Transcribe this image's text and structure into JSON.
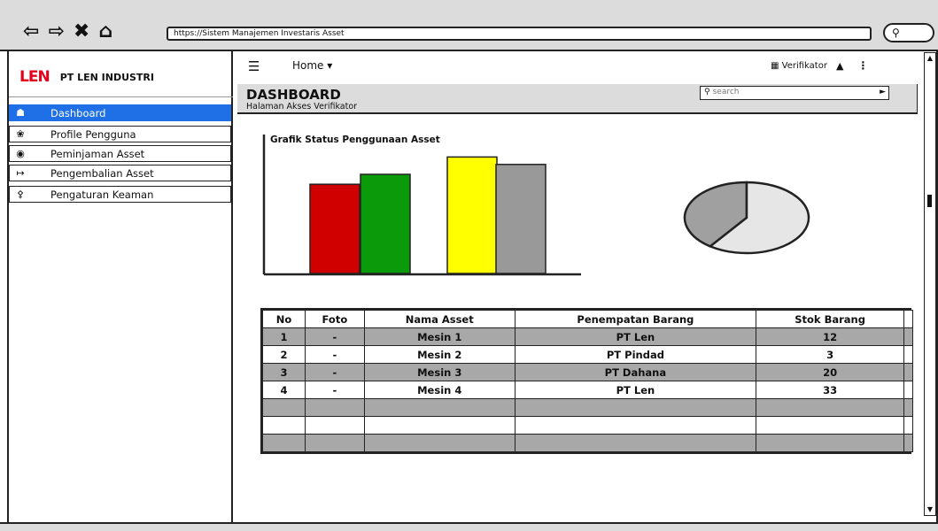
{
  "browser": {
    "nav_icons": [
      "back-arrow",
      "forward-arrow",
      "close-x",
      "home"
    ],
    "url": "https://Sistem Manajemen Investaris Asset",
    "menu_icon": "search-pill"
  },
  "sidebar": {
    "brand_logo": "LEN",
    "brand_name": "PT LEN INDUSTRI",
    "items": [
      {
        "label": "Dashboard",
        "icon": "home-icon",
        "active": true
      },
      {
        "label": "Profile Pengguna",
        "icon": "user-icon",
        "active": false
      },
      {
        "label": "Peminjaman Asset",
        "icon": "car-icon",
        "active": false
      },
      {
        "label": "Pengembalian Asset",
        "icon": "sign-out-icon",
        "active": false
      },
      {
        "label": "Pengaturan Keaman",
        "icon": "key-icon",
        "active": false
      }
    ]
  },
  "topbar": {
    "home_label": "Home",
    "user_label": "Verifikator"
  },
  "header": {
    "title": "DASHBOARD",
    "subtitle": "Halaman Akses Verifikator",
    "search_placeholder": "search"
  },
  "chart_data": [
    {
      "type": "bar",
      "title": "Grafik Status Penggunaan Asset",
      "categories": [
        "",
        "",
        "",
        ""
      ],
      "values": [
        72,
        80,
        94,
        88
      ],
      "colors": [
        "#d10000",
        "#0a9a0a",
        "#ffff00",
        "#999999"
      ],
      "ylim": [
        0,
        100
      ],
      "grid": false
    },
    {
      "type": "pie",
      "values": [
        40,
        60
      ],
      "colors": [
        "#a0a0a0",
        "#e6e6e6"
      ]
    }
  ],
  "table": {
    "columns": [
      "No",
      "Foto",
      "Nama Asset",
      "Penempatan Barang",
      "Stok Barang"
    ],
    "rows": [
      [
        "1",
        "-",
        "Mesin 1",
        "PT Len",
        "12"
      ],
      [
        "2",
        "-",
        "Mesin 2",
        "PT Pindad",
        "3"
      ],
      [
        "3",
        "-",
        "Mesin 3",
        "PT Dahana",
        "20"
      ],
      [
        "4",
        "-",
        "Mesin 4",
        "PT Len",
        "33"
      ]
    ],
    "empty_rows": 3
  },
  "colors": {
    "accent": "#1f6fe6",
    "chrome": "#dcdcdc",
    "row_shade": "#a8a8a8",
    "brand_red": "#e3001b"
  }
}
